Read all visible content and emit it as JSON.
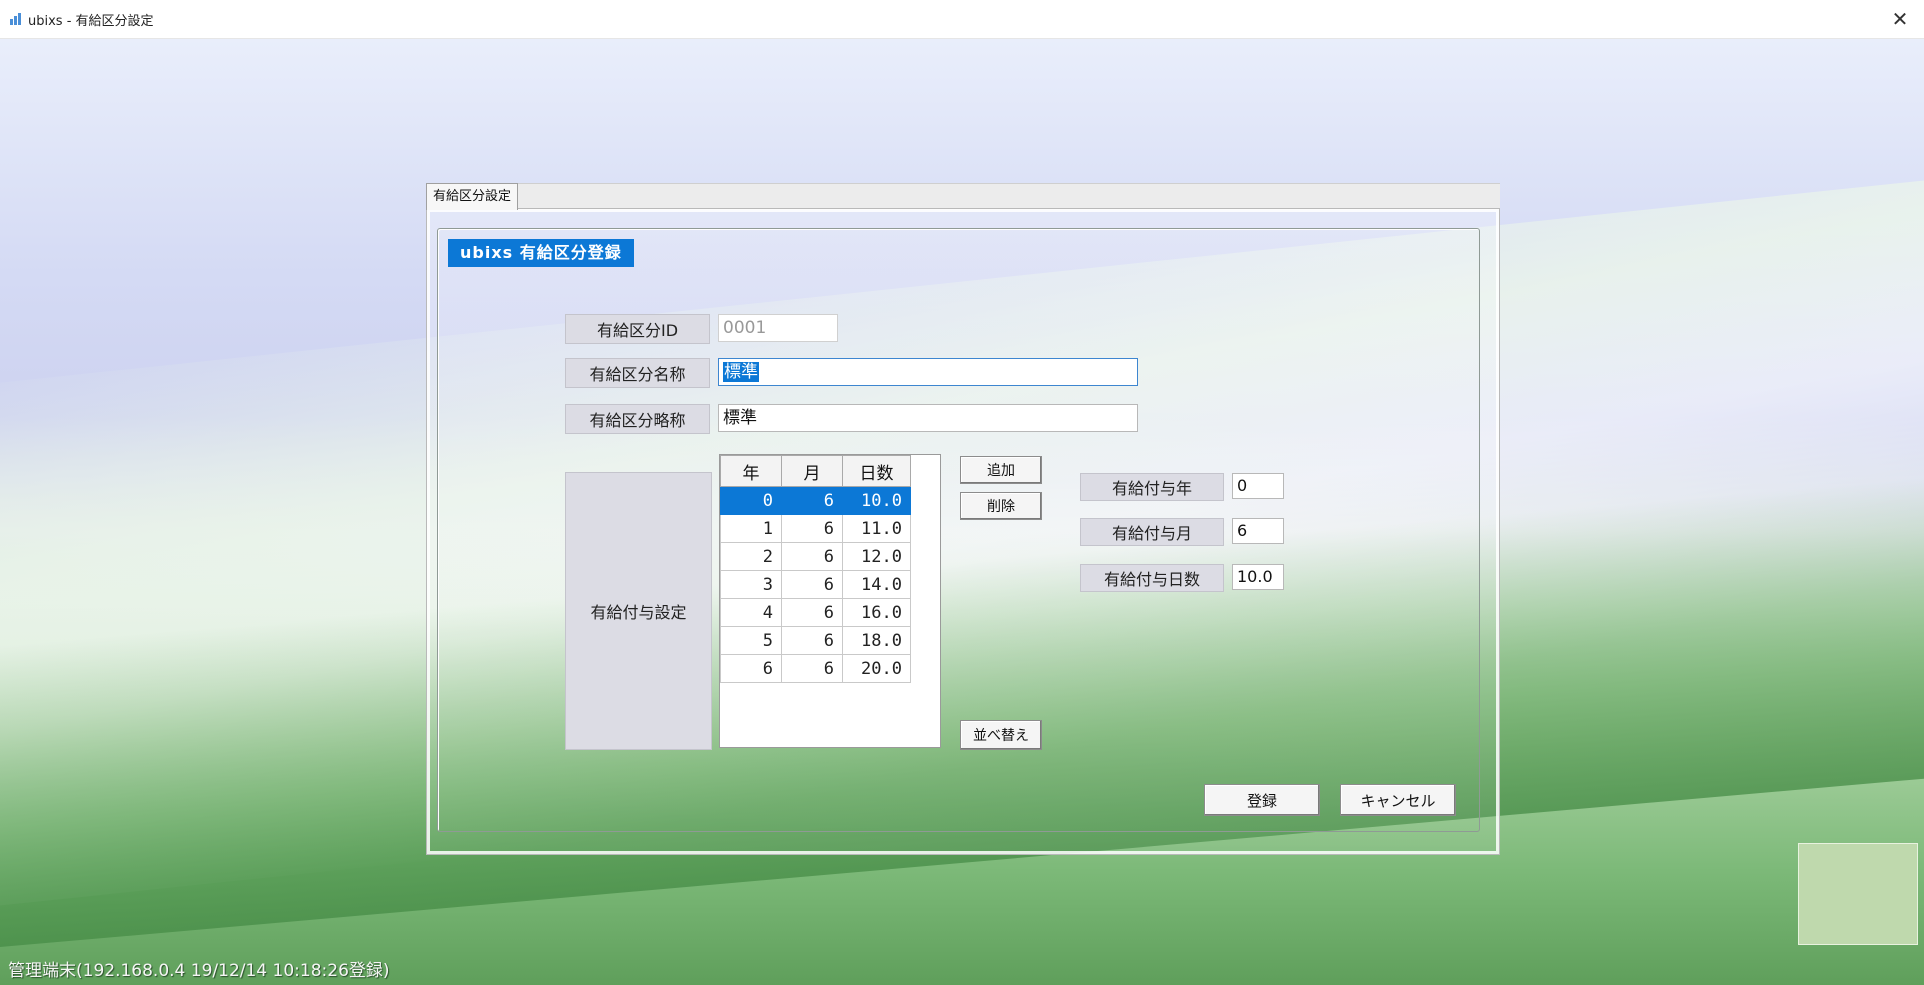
{
  "window": {
    "title": "ubixs - 有給区分設定",
    "close_symbol": "✕"
  },
  "tab": {
    "label": "有給区分設定"
  },
  "form": {
    "header": "ubixs 有給区分登録",
    "id_label": "有給区分ID",
    "id_value": "0001",
    "name_label": "有給区分名称",
    "name_value": "標準",
    "short_label": "有給区分略称",
    "short_value": "標準",
    "grant_setting_label": "有給付与設定"
  },
  "grid": {
    "columns": [
      "年",
      "月",
      "日数"
    ],
    "rows": [
      [
        "0",
        "6",
        "10.0"
      ],
      [
        "1",
        "6",
        "11.0"
      ],
      [
        "2",
        "6",
        "12.0"
      ],
      [
        "3",
        "6",
        "14.0"
      ],
      [
        "4",
        "6",
        "16.0"
      ],
      [
        "5",
        "6",
        "18.0"
      ],
      [
        "6",
        "6",
        "20.0"
      ]
    ],
    "selected_row": 0
  },
  "buttons": {
    "add": "追加",
    "delete": "削除",
    "sort": "並べ替え",
    "register": "登録",
    "cancel": "キャンセル"
  },
  "detail": {
    "year_label": "有給付与年",
    "year_value": "0",
    "month_label": "有給付与月",
    "month_value": "6",
    "days_label": "有給付与日数",
    "days_value": "10.0"
  },
  "status": {
    "text": "管理端末(192.168.0.4 19/12/14 10:18:26登録)"
  },
  "colors": {
    "accent": "#0c78d6",
    "label_bg": "#dcdce4"
  }
}
